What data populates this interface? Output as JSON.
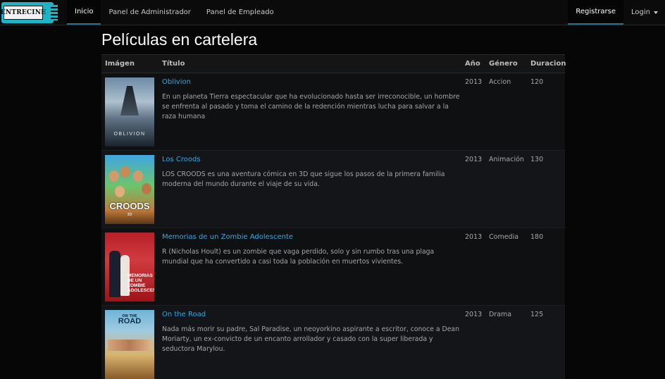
{
  "navbar": {
    "brand": "ENTRECINE",
    "items": [
      {
        "label": "Inicio",
        "active": true
      },
      {
        "label": "Panel de Administrador",
        "active": false
      },
      {
        "label": "Panel de Empleado",
        "active": false
      }
    ],
    "register_label": "Registrarse",
    "login_label": "Login"
  },
  "page": {
    "title": "Películas en cartelera"
  },
  "table": {
    "headers": {
      "image": "Imágen",
      "title": "Título",
      "year": "Año",
      "genre": "Género",
      "duration": "Duracion"
    },
    "rows": [
      {
        "title": "Oblivion",
        "description": "En un planeta Tierra espectacular que ha evolucionado hasta ser irreconocible, un hombre se enfrenta al pasado y toma el camino de la redención mientras lucha para salvar a la raza humana",
        "year": "2013",
        "genre": "Accion",
        "duration": "120",
        "poster_text": "OBLIVION"
      },
      {
        "title": "Los Croods",
        "description": "LOS CROODS es una aventura cómica en 3D que sigue los pasos de la primera familia moderna del mundo durante el viaje de su vida.",
        "year": "2013",
        "genre": "Animación",
        "duration": "130",
        "poster_text": "CROODS",
        "poster_sub": "3D"
      },
      {
        "title": "Memorias de un Zombie Adolescente",
        "description": "R (Nicholas Hoult) es un zombie que vaga perdido, solo y sin rumbo tras una plaga mundial que ha convertido a casi toda la población en muertos vivientes.",
        "year": "2013",
        "genre": "Comedia",
        "duration": "180",
        "poster_text": "MEMORIAS DE UN ZOMBIE ADOLESCENTE"
      },
      {
        "title": "On the Road",
        "description": "Nada más morir su padre, Sal Paradise, un neoyorkino aspirante a escritor, conoce a Dean Moriarty, un ex-convicto de un encanto arrollador y casado con la super liberada y seductora Marylou.",
        "year": "2013",
        "genre": "Drama",
        "duration": "125",
        "poster_text": "ROAD",
        "poster_top": "ON THE"
      }
    ]
  },
  "colors": {
    "link": "#3aa7dd",
    "brand_accent": "#1db4c8",
    "background": "#060606"
  }
}
